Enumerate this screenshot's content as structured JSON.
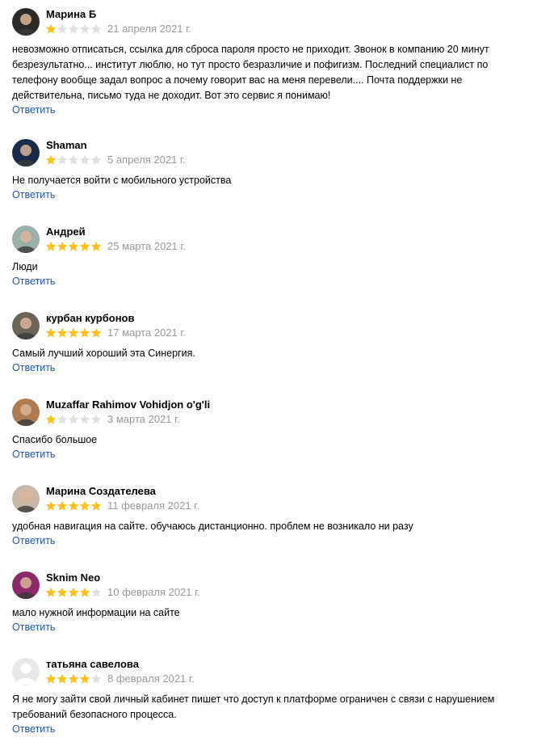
{
  "reviews": [
    {
      "name": "Марина Б",
      "rating": 1,
      "date": "21 апреля 2021 г.",
      "text": "невозможно отписаться, ссылка для сброса пароля просто не приходит. Звонок в компанию 20 минут безрезультатно... институт люблю, но тут просто безразличие и пофигизм. Последний специалист по телефону вообще задал вопрос а почему говорит вас на меня перевели.... Почта поддержки не действительна, письмо туда не доходит. Вот это сервис я понимаю!",
      "reply": "Ответить",
      "avatar": "avatar-marina-b",
      "bg": "#2a2a2a"
    },
    {
      "name": "Shaman",
      "rating": 1,
      "date": "5 апреля 2021 г.",
      "text": "Не получается войти с мобильного устройства",
      "reply": "Ответить",
      "avatar": "avatar-shaman",
      "bg": "#1a2a4a"
    },
    {
      "name": "Андрей",
      "rating": 5,
      "date": "25 марта 2021 г.",
      "text": "Люди",
      "reply": "Ответить",
      "avatar": "avatar-andrey",
      "bg": "#9bb0a8"
    },
    {
      "name": "курбан курбонов",
      "rating": 5,
      "date": "17 марта 2021 г.",
      "text": "Самый лучший хороший эта Синергия.",
      "reply": "Ответить",
      "avatar": "avatar-kurban",
      "bg": "#6b6458"
    },
    {
      "name": "Muzaffar Rahimov Vohidjon o'g'li",
      "rating": 1,
      "date": "3 марта 2021 г.",
      "text": "Спасибо большое",
      "reply": "Ответить",
      "avatar": "avatar-muzaffar",
      "bg": "#b07a50"
    },
    {
      "name": "Марина Создателева",
      "rating": 5,
      "date": "11 февраля 2021 г.",
      "text": "удобная навигация на сайте. обучаюсь дистанционно. проблем не возникало ни разу",
      "reply": "Ответить",
      "avatar": "avatar-marina-s",
      "bg": "#c9b8a8"
    },
    {
      "name": "Sknim Neo",
      "rating": 4,
      "date": "10 февраля 2021 г.",
      "text": "мало нужной информации на сайте",
      "reply": "Ответить",
      "avatar": "avatar-sknim",
      "bg": "#8a2a6a"
    },
    {
      "name": "татьяна савелова",
      "rating": 4,
      "date": "8 февраля 2021 г.",
      "text": "Я не могу зайти свой личный кабинет пишет что доступ к платформе ограничен с связи с нарушением требований безопасного процесса.",
      "reply": "Ответить",
      "avatar": "avatar-placeholder",
      "bg": "#e6e6e6"
    }
  ],
  "colors": {
    "star_filled": "#fcc21b",
    "star_empty": "#e0e0e0",
    "date": "#999999",
    "link": "#1f54b3"
  }
}
